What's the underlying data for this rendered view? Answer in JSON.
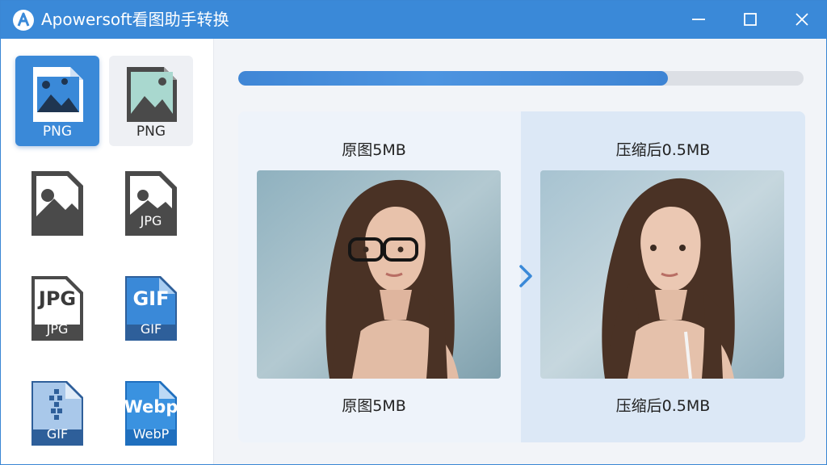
{
  "window": {
    "title": "Apowersoft看图助手转换",
    "logo_letter": "A",
    "accent": "#3a89d8"
  },
  "sidebar": {
    "formats": [
      {
        "label": "PNG",
        "icon": "png-image-icon",
        "selected": true
      },
      {
        "label": "PNG",
        "icon": "png-image-icon",
        "selected": false
      },
      {
        "label": "",
        "icon": "image-file-icon",
        "selected": false
      },
      {
        "label": "JPG",
        "icon": "jpg-file-icon",
        "selected": false
      },
      {
        "label": "JPG",
        "badge": "JPG",
        "icon": "jpg-file-icon",
        "selected": false
      },
      {
        "label": "GIF",
        "badge": "GIF",
        "icon": "gif-file-icon",
        "selected": false
      },
      {
        "label": "GIF",
        "icon": "gif-file-icon",
        "selected": false
      },
      {
        "label": "WebP",
        "badge": "Webp",
        "icon": "webp-file-icon",
        "selected": false
      }
    ]
  },
  "progress": {
    "value": 0.76
  },
  "compare": {
    "original_top": "原图5MB",
    "original_bottom": "原图5MB",
    "compressed_top": "压缩后0.5MB",
    "compressed_bottom": "压缩后0.5MB"
  }
}
